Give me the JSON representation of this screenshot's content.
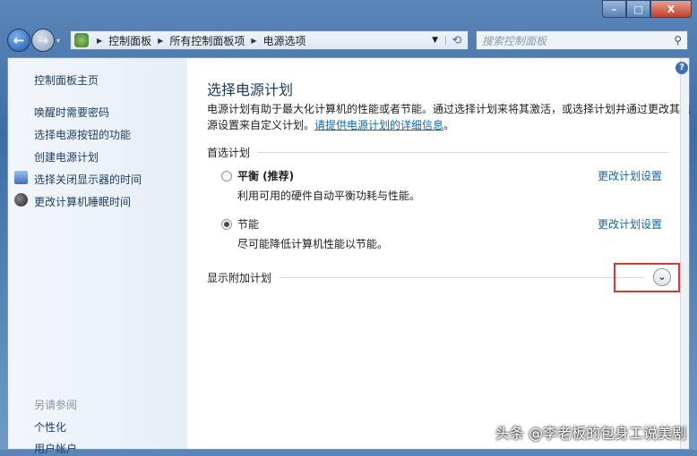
{
  "window": {
    "min": "–",
    "max": "□",
    "close": "X"
  },
  "nav": {
    "back": "←",
    "forward": "→",
    "dropdown": "▾"
  },
  "address": {
    "crumbs": [
      "控制面板",
      "所有控制面板项",
      "电源选项"
    ],
    "refresh": "⟲"
  },
  "search": {
    "placeholder": "搜索控制面板",
    "icon": "⚲"
  },
  "sidebar": {
    "home": "控制面板主页",
    "items": [
      {
        "label": "唤醒时需要密码"
      },
      {
        "label": "选择电源按钮的功能"
      },
      {
        "label": "创建电源计划"
      },
      {
        "label": "选择关闭显示器的时间"
      },
      {
        "label": "更改计算机睡眠时间"
      }
    ],
    "see_also": "另请参阅",
    "see_also_items": [
      "个性化",
      "用户帐户"
    ]
  },
  "main": {
    "title": "选择电源计划",
    "desc": "电源计划有助于最大化计算机的性能或者节能。通过选择计划来将其激活，或选择计划并通过更改其电源设置来自定义计划。",
    "desc_link": "请提供电源计划的详细信息",
    "desc_end": "。",
    "preferred": "首选计划",
    "plans": [
      {
        "name": "平衡 (推荐)",
        "desc": "利用可用的硬件自动平衡功耗与性能。",
        "change": "更改计划设置",
        "selected": false
      },
      {
        "name": "节能",
        "desc": "尽可能降低计算机性能以节能。",
        "change": "更改计划设置",
        "selected": true
      }
    ],
    "additional": "显示附加计划",
    "expand": "⌄",
    "help": "?"
  },
  "watermark": "头条 @李老板的包身工说美剧"
}
